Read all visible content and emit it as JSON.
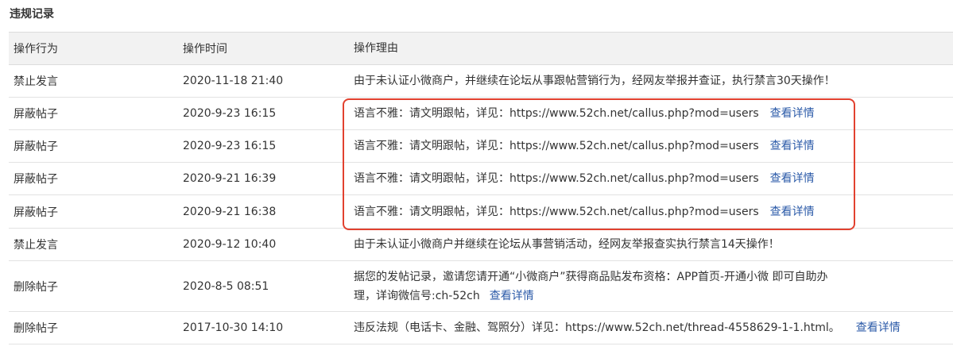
{
  "section_title": "违规记录",
  "table": {
    "headers": [
      "操作行为",
      "操作时间",
      "操作理由"
    ],
    "rows": [
      {
        "action": "禁止发言",
        "time": "2020-11-18 21:40",
        "reason": "由于未认证小微商户，并继续在论坛从事跟帖营销行为，经网友举报并查证，执行禁言30天操作！",
        "link": ""
      },
      {
        "action": "屏蔽帖子",
        "time": "2020-9-23 16:15",
        "reason": "语言不雅：请文明跟帖，详见：https://www.52ch.net/callus.php?mod=users",
        "link": "查看详情"
      },
      {
        "action": "屏蔽帖子",
        "time": "2020-9-23 16:15",
        "reason": "语言不雅：请文明跟帖，详见：https://www.52ch.net/callus.php?mod=users",
        "link": "查看详情"
      },
      {
        "action": "屏蔽帖子",
        "time": "2020-9-21 16:39",
        "reason": "语言不雅：请文明跟帖，详见：https://www.52ch.net/callus.php?mod=users",
        "link": "查看详情"
      },
      {
        "action": "屏蔽帖子",
        "time": "2020-9-21 16:38",
        "reason": "语言不雅：请文明跟帖，详见：https://www.52ch.net/callus.php?mod=users",
        "link": "查看详情"
      },
      {
        "action": "禁止发言",
        "time": "2020-9-12 10:40",
        "reason": "由于未认证小微商户并继续在论坛从事营销活动，经网友举报查实执行禁言14天操作！",
        "link": ""
      },
      {
        "action": "删除帖子",
        "time": "2020-8-5 08:51",
        "reason": "据您的发帖记录，邀请您请开通“小微商户”获得商品贴发布资格：APP首页-开通小微 即可自助办理，详询微信号:ch-52ch",
        "link": "查看详情"
      },
      {
        "action": "删除帖子",
        "time": "2017-10-30 14:10",
        "reason": "违反法规（电话卡、金融、驾照分）详见：https://www.52ch.net/thread-4558629-1-1.html。",
        "link": "查看详情"
      }
    ]
  },
  "colors": {
    "link": "#2b5aa8",
    "highlight": "#e2412f",
    "header_bg": "#f2f2f2"
  }
}
